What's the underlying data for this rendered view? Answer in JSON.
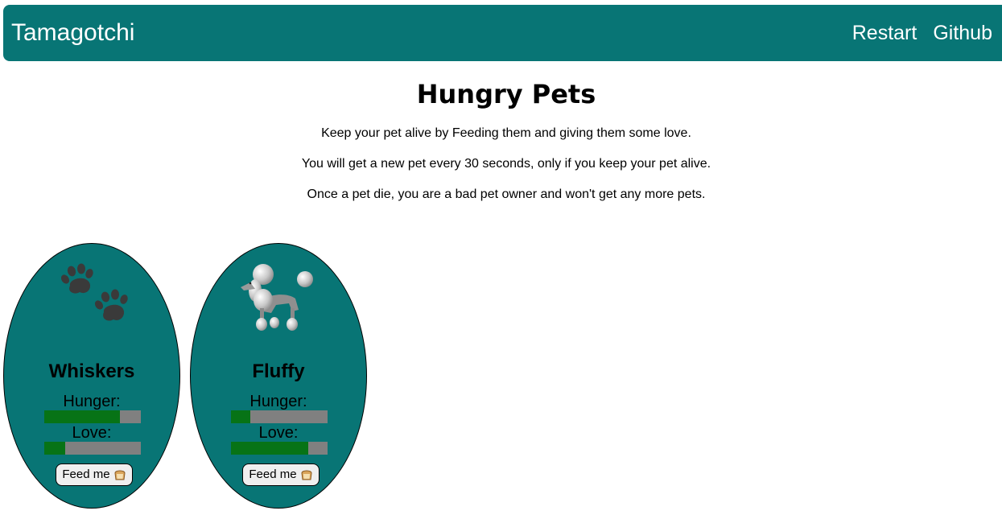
{
  "navbar": {
    "brand": "Tamagotchi",
    "links": [
      "Restart",
      "Github"
    ]
  },
  "main": {
    "title": "Hungry Pets",
    "paragraphs": [
      "Keep your pet alive by Feeding them and giving them some love.",
      "You will get a new pet every 30 seconds, only if you keep your pet alive.",
      "Once a pet die, you are a bad pet owner and won't get any more pets."
    ]
  },
  "pets": [
    {
      "name": "Whiskers",
      "icon": "paw-prints-icon",
      "hunger_label": "Hunger:",
      "hunger": 0.78,
      "love_label": "Love:",
      "love": 0.22,
      "feed_label": "Feed me",
      "feed_icon": "bread-icon"
    },
    {
      "name": "Fluffy",
      "icon": "poodle-icon",
      "hunger_label": "Hunger:",
      "hunger": 0.2,
      "love_label": "Love:",
      "love": 0.8,
      "feed_label": "Feed me",
      "feed_icon": "bread-icon"
    }
  ],
  "colors": {
    "primary": "#087575",
    "bar_fill": "#077316",
    "bar_track": "#808080"
  }
}
